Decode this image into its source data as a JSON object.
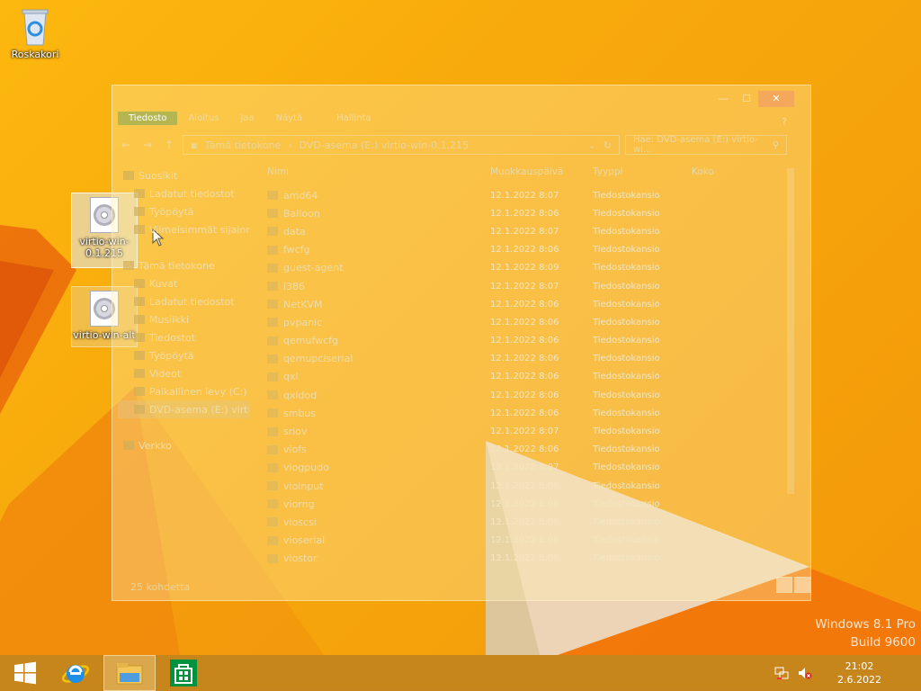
{
  "desktop": {
    "recycle_bin": "Roskakori",
    "icons": [
      {
        "label": "virtio-win-0.1.215",
        "selected": true
      },
      {
        "label": "virtio-win-alt",
        "selected": false
      }
    ]
  },
  "window": {
    "ribbon_tabs": [
      "Tiedosto",
      "Aloitus",
      "Jaa",
      "Näytä",
      "Hallinta"
    ],
    "help": "?",
    "address": {
      "crumbs": [
        "Tämä tietokone",
        "DVD-asema (E:) virtio-win-0.1.215"
      ],
      "search_placeholder": "Hae: DVD-asema (E:) virtio-wi..."
    },
    "nav": [
      {
        "label": "Suosikit",
        "level": 0
      },
      {
        "label": "Ladatut tiedostot",
        "level": 1
      },
      {
        "label": "Työpöytä",
        "level": 1
      },
      {
        "label": "Viimeisimmät sijainnit",
        "level": 1
      },
      {
        "label": "Tämä tietokone",
        "level": 0
      },
      {
        "label": "Kuvat",
        "level": 1
      },
      {
        "label": "Ladatut tiedostot",
        "level": 1
      },
      {
        "label": "Musiikki",
        "level": 1
      },
      {
        "label": "Tiedostot",
        "level": 1
      },
      {
        "label": "Työpöytä",
        "level": 1
      },
      {
        "label": "Videot",
        "level": 1
      },
      {
        "label": "Paikallinen levy (C:)",
        "level": 1
      },
      {
        "label": "DVD-asema (E:) virtio",
        "level": 1,
        "selected": true
      },
      {
        "label": "Verkko",
        "level": 0
      }
    ],
    "columns": {
      "name": "Nimi",
      "date": "Muokkauspäivä",
      "type": "Tyyppi",
      "size": "Koko"
    },
    "files": [
      {
        "name": "amd64",
        "date": "12.1.2022 8:07",
        "type": "Tiedostokansio"
      },
      {
        "name": "Balloon",
        "date": "12.1.2022 8:06",
        "type": "Tiedostokansio"
      },
      {
        "name": "data",
        "date": "12.1.2022 8:07",
        "type": "Tiedostokansio"
      },
      {
        "name": "fwcfg",
        "date": "12.1.2022 8:06",
        "type": "Tiedostokansio"
      },
      {
        "name": "guest-agent",
        "date": "12.1.2022 8:09",
        "type": "Tiedostokansio"
      },
      {
        "name": "i386",
        "date": "12.1.2022 8:07",
        "type": "Tiedostokansio"
      },
      {
        "name": "NetKVM",
        "date": "12.1.2022 8:06",
        "type": "Tiedostokansio"
      },
      {
        "name": "pvpanic",
        "date": "12.1.2022 8:06",
        "type": "Tiedostokansio"
      },
      {
        "name": "qemufwcfg",
        "date": "12.1.2022 8:06",
        "type": "Tiedostokansio"
      },
      {
        "name": "qemupciserial",
        "date": "12.1.2022 8:06",
        "type": "Tiedostokansio"
      },
      {
        "name": "qxl",
        "date": "12.1.2022 8:06",
        "type": "Tiedostokansio"
      },
      {
        "name": "qxldod",
        "date": "12.1.2022 8:06",
        "type": "Tiedostokansio"
      },
      {
        "name": "smbus",
        "date": "12.1.2022 8:06",
        "type": "Tiedostokansio"
      },
      {
        "name": "sriov",
        "date": "12.1.2022 8:07",
        "type": "Tiedostokansio"
      },
      {
        "name": "viofs",
        "date": "12.1.2022 8:06",
        "type": "Tiedostokansio"
      },
      {
        "name": "viogpudo",
        "date": "12.1.2022 8:07",
        "type": "Tiedostokansio"
      },
      {
        "name": "vioinput",
        "date": "12.1.2022 8:06",
        "type": "Tiedostokansio"
      },
      {
        "name": "viorng",
        "date": "12.1.2022 8:06",
        "type": "Tiedostokansio"
      },
      {
        "name": "vioscsi",
        "date": "12.1.2022 8:06",
        "type": "Tiedostokansio"
      },
      {
        "name": "vioserial",
        "date": "12.1.2022 8:06",
        "type": "Tiedostokansio"
      },
      {
        "name": "viostor",
        "date": "12.1.2022 8:06",
        "type": "Tiedostokansio"
      }
    ],
    "status": "25 kohdetta"
  },
  "watermark": {
    "line1": "Windows 8.1 Pro",
    "line2": "Build 9600"
  },
  "taskbar": {
    "time": "21:02",
    "date": "2.6.2022"
  },
  "colors": {
    "accent": "#f6a40b",
    "taskbar": "#c4841e"
  }
}
